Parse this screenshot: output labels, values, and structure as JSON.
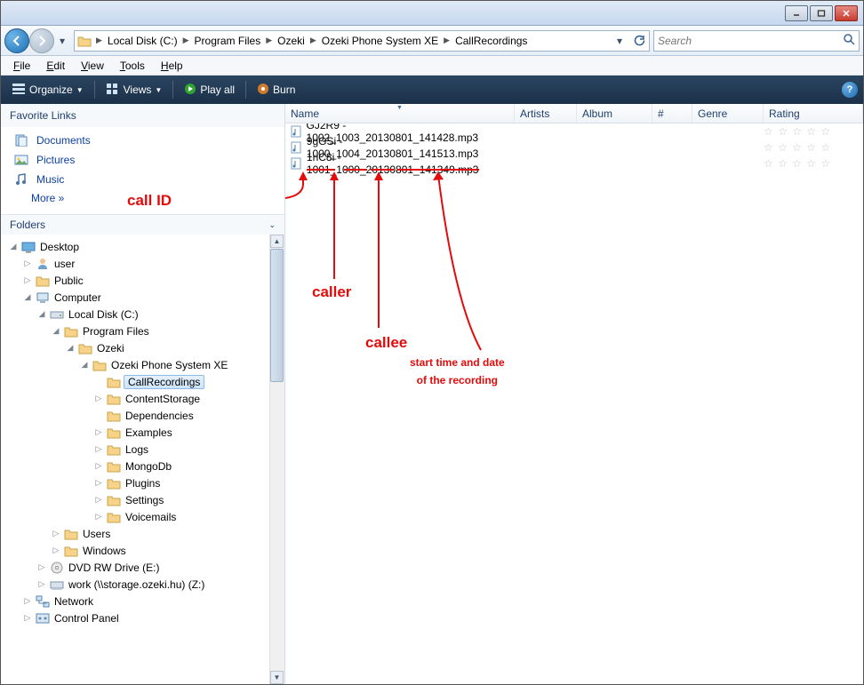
{
  "titlebar": {},
  "nav": {
    "breadcrumbs": [
      "Local Disk (C:)",
      "Program Files",
      "Ozeki",
      "Ozeki Phone System XE",
      "CallRecordings"
    ]
  },
  "search": {
    "placeholder": "Search"
  },
  "menu": {
    "file": "File",
    "edit": "Edit",
    "view": "View",
    "tools": "Tools",
    "help": "Help"
  },
  "toolbar": {
    "organize": "Organize",
    "views": "Views",
    "playall": "Play all",
    "burn": "Burn"
  },
  "favorites": {
    "header": "Favorite Links",
    "documents": "Documents",
    "pictures": "Pictures",
    "music": "Music",
    "more": "More  »"
  },
  "folders": {
    "header": "Folders",
    "tree": {
      "desktop": "Desktop",
      "user": "user",
      "public": "Public",
      "computer": "Computer",
      "localdisk": "Local Disk (C:)",
      "programfiles": "Program Files",
      "ozeki": "Ozeki",
      "oxe": "Ozeki Phone System XE",
      "callrecordings": "CallRecordings",
      "contentstorage": "ContentStorage",
      "dependencies": "Dependencies",
      "examples": "Examples",
      "logs": "Logs",
      "mongodb": "MongoDb",
      "plugins": "Plugins",
      "settings": "Settings",
      "voicemails": "Voicemails",
      "users": "Users",
      "windows": "Windows",
      "dvd": "DVD RW Drive (E:)",
      "work": "work (\\\\storage.ozeki.hu) (Z:)",
      "network": "Network",
      "controlpanel": "Control Panel"
    }
  },
  "columns": {
    "name": "Name",
    "artists": "Artists",
    "album": "Album",
    "num": "#",
    "genre": "Genre",
    "rating": "Rating"
  },
  "files": {
    "f0": "GJ2R9 - 1002_1003_20130801_141428.mp3",
    "f1": "9gGSi - 1000_1004_20130801_141513.mp3",
    "f2": "1riC8i - 1001_1000_20130801_141349.mp3"
  },
  "rating_stars": "☆ ☆ ☆ ☆ ☆",
  "annotations": {
    "callid": "call ID",
    "caller": "caller",
    "callee": "callee",
    "datetime1": "start time and date",
    "datetime2": "of the recording"
  }
}
